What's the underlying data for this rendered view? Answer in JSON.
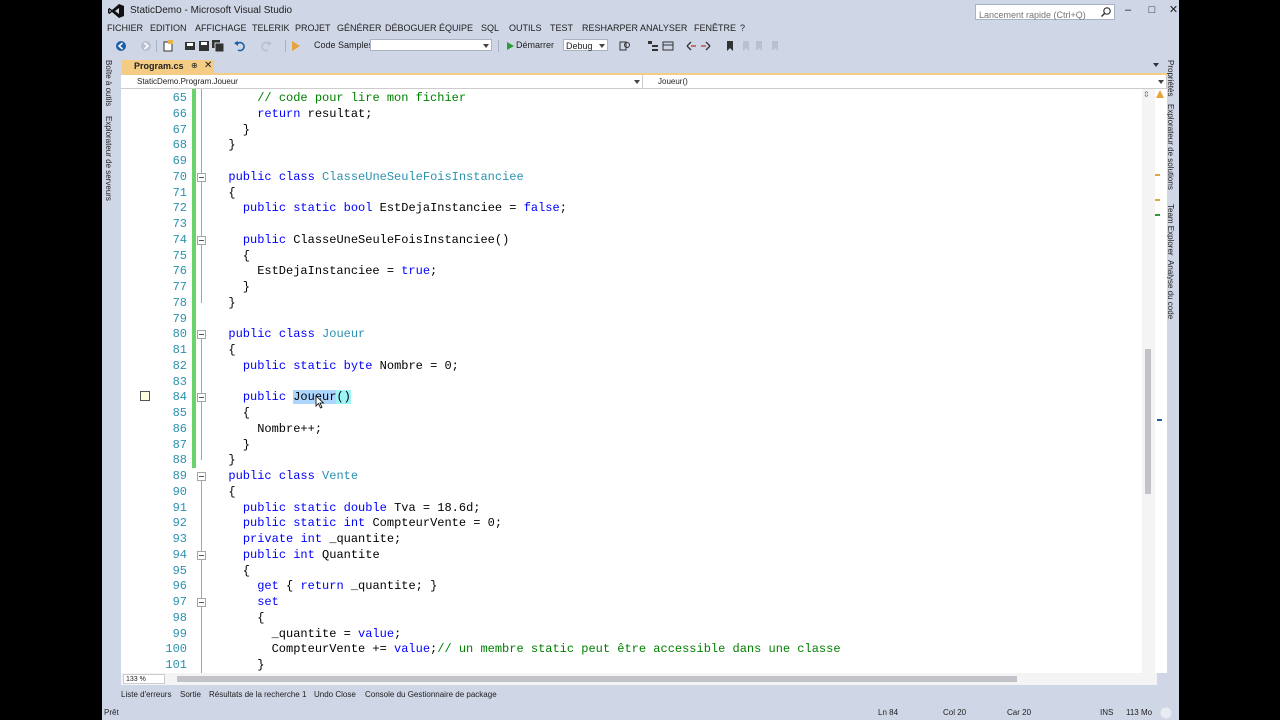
{
  "window": {
    "title": "StaticDemo - Microsoft Visual Studio",
    "quick_launch_placeholder": "Lancement rapide (Ctrl+Q)"
  },
  "menu": [
    "FICHIER",
    "EDITION",
    "AFFICHAGE",
    "TELERIK",
    "PROJET",
    "GÉNÉRER",
    "DÉBOGUER",
    "ÉQUIPE",
    "SQL",
    "OUTILS",
    "TEST",
    "RESHARPER",
    "ANALYSER",
    "FENÊTRE",
    "?"
  ],
  "toolbar": {
    "code_samples_label": "Code Samples",
    "start_label": "Démarrer",
    "configuration": "Debug"
  },
  "left_tabs": [
    "Boîte à outils",
    "Explorateur de serveurs"
  ],
  "right_tabs": [
    "Propriétés",
    "Explorateur de solutions",
    "Team Explorer",
    "Analyse du code"
  ],
  "document_tab": {
    "name": "Program.cs",
    "pin": "⊕",
    "close": "✕"
  },
  "nav_bar": {
    "type_combo": "StaticDemo.Program.Joueur",
    "member_combo": "Joueur()"
  },
  "editor": {
    "zoom": "133 %",
    "lines": [
      {
        "n": "65",
        "code": [
          [
            "      ",
            ""
          ],
          [
            "// code pour lire mon fichier",
            "cm"
          ]
        ]
      },
      {
        "n": "66",
        "code": [
          [
            "      ",
            ""
          ],
          [
            "return",
            "kw"
          ],
          [
            " resultat;",
            ""
          ]
        ]
      },
      {
        "n": "67",
        "code": [
          [
            "    }",
            ""
          ]
        ]
      },
      {
        "n": "68",
        "code": [
          [
            "  }",
            ""
          ]
        ]
      },
      {
        "n": "69",
        "code": [
          [
            "",
            ""
          ]
        ]
      },
      {
        "n": "70",
        "code": [
          [
            "  ",
            ""
          ],
          [
            "public",
            "kw"
          ],
          [
            " ",
            ""
          ],
          [
            "class",
            "kw"
          ],
          [
            " ",
            ""
          ],
          [
            "ClasseUneSeuleFoisInstanciee",
            "ty"
          ]
        ]
      },
      {
        "n": "71",
        "code": [
          [
            "  {",
            ""
          ]
        ]
      },
      {
        "n": "72",
        "code": [
          [
            "    ",
            ""
          ],
          [
            "public",
            "kw"
          ],
          [
            " ",
            ""
          ],
          [
            "static",
            "kw"
          ],
          [
            " ",
            ""
          ],
          [
            "bool",
            "kw"
          ],
          [
            " EstDejaInstanciee = ",
            ""
          ],
          [
            "false",
            "kw"
          ],
          [
            ";",
            ""
          ]
        ]
      },
      {
        "n": "73",
        "code": [
          [
            "",
            ""
          ]
        ]
      },
      {
        "n": "74",
        "code": [
          [
            "    ",
            ""
          ],
          [
            "public",
            "kw"
          ],
          [
            " ClasseUneSeuleFoisInstanciee()",
            ""
          ]
        ]
      },
      {
        "n": "75",
        "code": [
          [
            "    {",
            ""
          ]
        ]
      },
      {
        "n": "76",
        "code": [
          [
            "      EstDejaInstanciee = ",
            ""
          ],
          [
            "true",
            "kw"
          ],
          [
            ";",
            ""
          ]
        ]
      },
      {
        "n": "77",
        "code": [
          [
            "    }",
            ""
          ]
        ]
      },
      {
        "n": "78",
        "code": [
          [
            "  }",
            ""
          ]
        ]
      },
      {
        "n": "79",
        "code": [
          [
            "",
            ""
          ]
        ]
      },
      {
        "n": "80",
        "code": [
          [
            "  ",
            ""
          ],
          [
            "public",
            "kw"
          ],
          [
            " ",
            ""
          ],
          [
            "class",
            "kw"
          ],
          [
            " ",
            ""
          ],
          [
            "Joueur",
            "ty"
          ]
        ]
      },
      {
        "n": "81",
        "code": [
          [
            "  {",
            ""
          ]
        ]
      },
      {
        "n": "82",
        "code": [
          [
            "    ",
            ""
          ],
          [
            "public",
            "kw"
          ],
          [
            " ",
            ""
          ],
          [
            "static",
            "kw"
          ],
          [
            " ",
            ""
          ],
          [
            "byte",
            "kw"
          ],
          [
            " Nombre = 0;",
            ""
          ]
        ]
      },
      {
        "n": "83",
        "code": [
          [
            "",
            ""
          ]
        ]
      },
      {
        "n": "84",
        "code": [
          [
            "    ",
            ""
          ],
          [
            "public",
            "kw"
          ],
          [
            " ",
            ""
          ],
          [
            "Joueur",
            "sel"
          ],
          [
            "()",
            "bm"
          ]
        ]
      },
      {
        "n": "85",
        "code": [
          [
            "    {",
            ""
          ]
        ]
      },
      {
        "n": "86",
        "code": [
          [
            "      Nombre++;",
            ""
          ]
        ]
      },
      {
        "n": "87",
        "code": [
          [
            "    }",
            ""
          ]
        ]
      },
      {
        "n": "88",
        "code": [
          [
            "  }",
            ""
          ]
        ]
      },
      {
        "n": "89",
        "code": [
          [
            "  ",
            ""
          ],
          [
            "public",
            "kw"
          ],
          [
            " ",
            ""
          ],
          [
            "class",
            "kw"
          ],
          [
            " ",
            ""
          ],
          [
            "Vente",
            "ty"
          ]
        ]
      },
      {
        "n": "90",
        "code": [
          [
            "  {",
            ""
          ]
        ]
      },
      {
        "n": "91",
        "code": [
          [
            "    ",
            ""
          ],
          [
            "public",
            "kw"
          ],
          [
            " ",
            ""
          ],
          [
            "static",
            "kw"
          ],
          [
            " ",
            ""
          ],
          [
            "double",
            "kw"
          ],
          [
            " Tva = 18.6d;",
            ""
          ]
        ]
      },
      {
        "n": "92",
        "code": [
          [
            "    ",
            ""
          ],
          [
            "public",
            "kw"
          ],
          [
            " ",
            ""
          ],
          [
            "static",
            "kw"
          ],
          [
            " ",
            ""
          ],
          [
            "int",
            "kw"
          ],
          [
            " CompteurVente = 0;",
            ""
          ]
        ]
      },
      {
        "n": "93",
        "code": [
          [
            "    ",
            ""
          ],
          [
            "private",
            "kw"
          ],
          [
            " ",
            ""
          ],
          [
            "int",
            "kw"
          ],
          [
            " _quantite;",
            ""
          ]
        ]
      },
      {
        "n": "94",
        "code": [
          [
            "    ",
            ""
          ],
          [
            "public",
            "kw"
          ],
          [
            " ",
            ""
          ],
          [
            "int",
            "kw"
          ],
          [
            " Quantite",
            ""
          ]
        ]
      },
      {
        "n": "95",
        "code": [
          [
            "    {",
            ""
          ]
        ]
      },
      {
        "n": "96",
        "code": [
          [
            "      ",
            ""
          ],
          [
            "get",
            "kw"
          ],
          [
            " { ",
            ""
          ],
          [
            "return",
            "kw"
          ],
          [
            " _quantite; }",
            ""
          ]
        ]
      },
      {
        "n": "97",
        "code": [
          [
            "      ",
            ""
          ],
          [
            "set",
            "kw"
          ]
        ]
      },
      {
        "n": "98",
        "code": [
          [
            "      {",
            ""
          ]
        ]
      },
      {
        "n": "99",
        "code": [
          [
            "        _quantite = ",
            ""
          ],
          [
            "value",
            "kw"
          ],
          [
            ";",
            ""
          ]
        ]
      },
      {
        "n": "100",
        "code": [
          [
            "        CompteurVente += ",
            ""
          ],
          [
            "value",
            "kw"
          ],
          [
            ";",
            ""
          ],
          [
            "// un membre static peut être accessible dans une classe",
            "cm"
          ]
        ]
      },
      {
        "n": "101",
        "code": [
          [
            "      }",
            ""
          ]
        ]
      }
    ]
  },
  "bottom_tabs": [
    "Liste d'erreurs",
    "Sortie",
    "Résultats de la recherche 1",
    "Undo Close",
    "Console du Gestionnaire de package"
  ],
  "status": {
    "state": "Prêt",
    "line": "Ln 84",
    "col": "Col 20",
    "char": "Car 20",
    "mode": "INS",
    "memory": "113 Mo"
  },
  "colors": {
    "chrome": "#cfd6e5",
    "active_tab": "#f5cc84",
    "keyword": "#0000ff",
    "type": "#2b91af",
    "comment": "#008000",
    "change_bar": "#6ad36a"
  }
}
